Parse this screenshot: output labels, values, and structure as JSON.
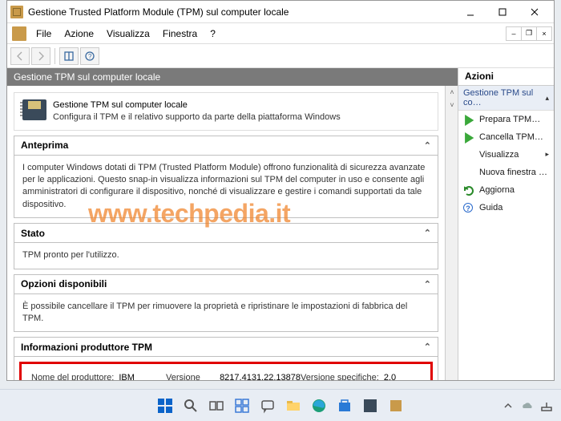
{
  "window": {
    "title": "Gestione Trusted Platform Module (TPM) sul computer locale"
  },
  "menu": {
    "file": "File",
    "azione": "Azione",
    "visualizza": "Visualizza",
    "finestra": "Finestra",
    "help": "?"
  },
  "panel": {
    "header": "Gestione TPM sul computer locale"
  },
  "info": {
    "title": "Gestione TPM sul computer locale",
    "desc": "Configura il TPM e il relativo supporto da parte della piattaforma Windows"
  },
  "sections": {
    "anteprima": {
      "title": "Anteprima",
      "body": "I computer Windows dotati di TPM (Trusted Platform Module) offrono funzionalità di sicurezza avanzate per le applicazioni. Questo snap-in visualizza informazioni sul TPM del computer in uso e consente agli amministratori di configurare il dispositivo, nonché di visualizzare e gestire i comandi supportati da tale dispositivo."
    },
    "stato": {
      "title": "Stato",
      "body": "TPM pronto per l'utilizzo."
    },
    "opzioni": {
      "title": "Opzioni disponibili",
      "body": "È possibile cancellare il TPM per rimuovere la proprietà e ripristinare le impostazioni di fabbrica del TPM."
    },
    "produttore": {
      "title": "Informazioni produttore TPM",
      "manuf_label": "Nome del produttore:",
      "manuf_value": "IBM",
      "ver_label": "Versione produttore:",
      "ver_value": "8217.4131.22.13878",
      "spec_label": "Versione specifiche:",
      "spec_value": "2.0"
    }
  },
  "actions": {
    "header": "Azioni",
    "group": "Gestione TPM sul co…",
    "prepare": "Prepara TPM…",
    "clear": "Cancella TPM…",
    "view": "Visualizza",
    "newwin": "Nuova finestra …",
    "refresh": "Aggiorna",
    "help": "Guida"
  },
  "watermark": "www.techpedia.it"
}
